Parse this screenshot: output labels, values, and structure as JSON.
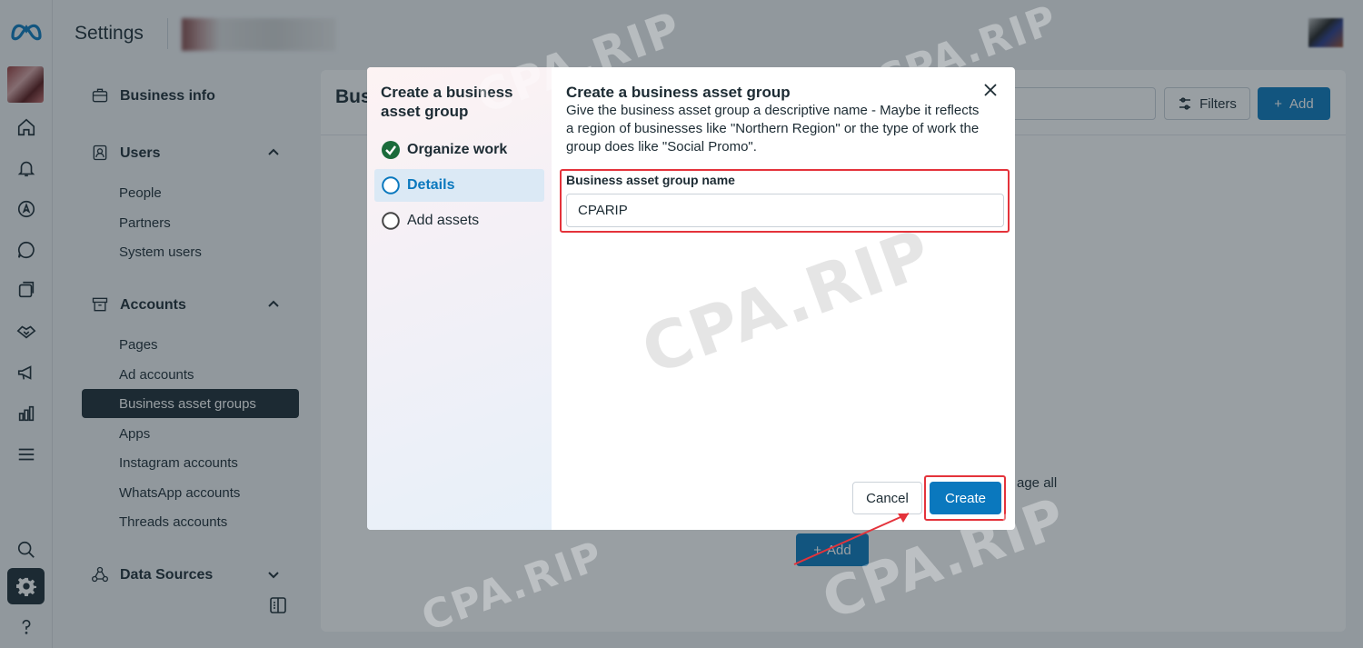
{
  "header": {
    "title": "Settings"
  },
  "nav": {
    "business_info": "Business info",
    "users": {
      "label": "Users",
      "items": [
        "People",
        "Partners",
        "System users"
      ]
    },
    "accounts": {
      "label": "Accounts",
      "items": [
        "Pages",
        "Ad accounts",
        "Business asset groups",
        "Apps",
        "Instagram accounts",
        "WhatsApp accounts",
        "Threads accounts"
      ]
    },
    "data_sources": "Data Sources",
    "active_item": "Business asset groups"
  },
  "main": {
    "title": "Bus",
    "filters_label": "Filters",
    "add_label": "Add",
    "empty_text": "age all",
    "empty_add_label": "Add"
  },
  "dialog": {
    "side_title": "Create a business asset group",
    "steps": [
      {
        "label": "Organize work",
        "state": "done"
      },
      {
        "label": "Details",
        "state": "current"
      },
      {
        "label": "Add assets",
        "state": "todo"
      }
    ],
    "title": "Create a business asset group",
    "description": "Give the business asset group a descriptive name - Maybe it reflects a region of businesses like \"Northern Region\" or the type of work the group does like \"Social Promo\".",
    "field_label": "Business asset group name",
    "field_value": "CPARIP",
    "cancel_label": "Cancel",
    "create_label": "Create"
  },
  "watermark": "CPA.RIP",
  "colors": {
    "primary": "#0a78be",
    "highlight": "#e4333b",
    "dark": "#1c2b33",
    "success": "#31a24c"
  }
}
